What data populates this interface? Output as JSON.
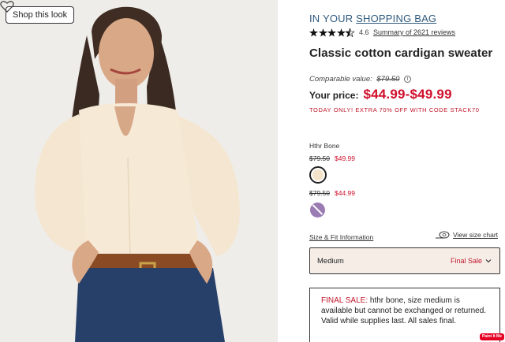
{
  "image_area": {
    "shop_button": "Shop this look",
    "heart_icon": "heart-outline"
  },
  "product": {
    "bag_prefix": "IN YOUR",
    "bag_link": "SHOPPING BAG",
    "rating": "4.6",
    "stars_filled": 4.5,
    "reviews_link": "Summary of 2621 reviews",
    "title": "Classic cotton cardigan sweater",
    "comparable_label": "Comparable value:",
    "comparable_value": "$79.50",
    "your_price_label": "Your price:",
    "price_range": "$44.99-$49.99",
    "promo": "TODAY ONLY! EXTRA 70% OFF WITH CODE STACK70"
  },
  "colors": {
    "selected_name": "Hthr Bone",
    "options": [
      {
        "old_price": "$79.50",
        "new_price": "$49.99",
        "color": "#f3e3c8"
      },
      {
        "old_price": "$79.50",
        "new_price": "$44.99",
        "color": "#9a7bb3"
      }
    ]
  },
  "size": {
    "fit_link": "Size & Fit Information",
    "chart_link": "View size chart",
    "selected": "Medium",
    "status": "Final Sale"
  },
  "final_sale": {
    "label": "FINAL SALE:",
    "text": " hthr bone, size medium is available but cannot be exchanged or returned. Valid while supplies last. All sales final."
  },
  "pin_button": "Paint It Me",
  "colors_theme": {
    "accent_red": "#d0102c",
    "link_blue": "#2f5a7e"
  }
}
